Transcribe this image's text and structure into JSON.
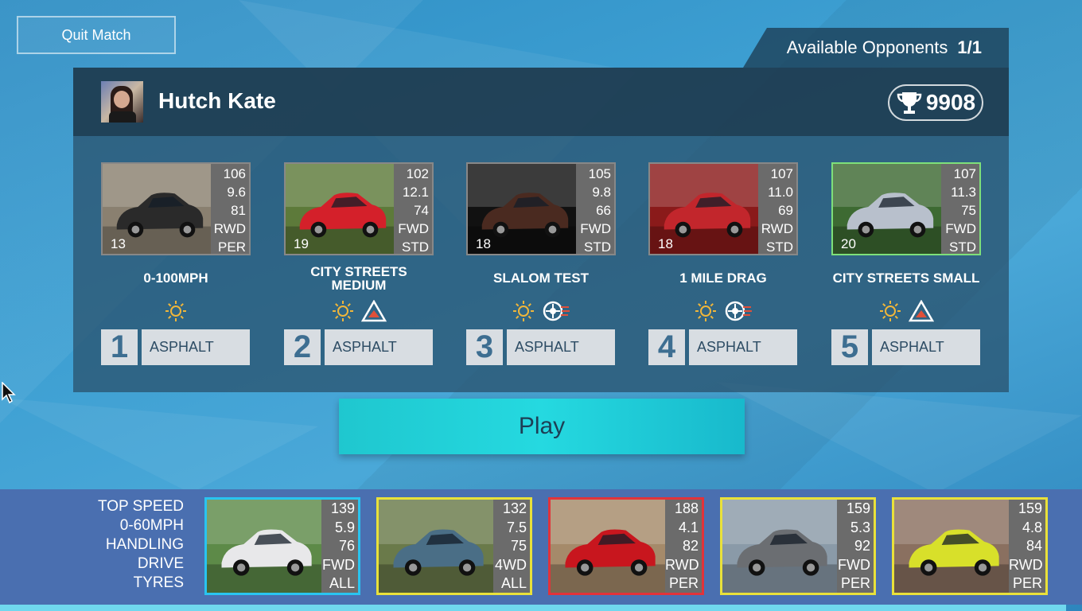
{
  "header": {
    "quit_label": "Quit Match",
    "available_label": "Available Opponents",
    "available_count": "1/1"
  },
  "opponent": {
    "name": "Hutch Kate",
    "trophies": "9908",
    "cars": [
      {
        "stats": [
          "106",
          "9.6",
          "81",
          "RWD",
          "PER"
        ],
        "rating": "13",
        "color": "#2a2a2a",
        "bg": "#8a8070"
      },
      {
        "stats": [
          "102",
          "12.1",
          "74",
          "FWD",
          "STD"
        ],
        "rating": "19",
        "color": "#d4202a",
        "bg": "#5d7a3a"
      },
      {
        "stats": [
          "105",
          "9.8",
          "66",
          "FWD",
          "STD"
        ],
        "rating": "18",
        "color": "#4a2a20",
        "bg": "#111111"
      },
      {
        "stats": [
          "107",
          "11.0",
          "69",
          "RWD",
          "STD"
        ],
        "rating": "18",
        "color": "#c2262c",
        "bg": "#8a1a1a"
      },
      {
        "stats": [
          "107",
          "11.3",
          "75",
          "FWD",
          "STD"
        ],
        "rating": "20",
        "color": "#b8c0cc",
        "bg": "#3d6a32"
      }
    ]
  },
  "events": [
    {
      "name": "0-100MPH",
      "number": "1",
      "surface": "ASPHALT",
      "icons": [
        "sun-icon"
      ]
    },
    {
      "name": "CITY STREETS MEDIUM",
      "number": "2",
      "surface": "ASPHALT",
      "icons": [
        "sun-icon",
        "warning-triangle-icon"
      ]
    },
    {
      "name": "SLALOM TEST",
      "number": "3",
      "surface": "ASPHALT",
      "icons": [
        "sun-icon",
        "tyre-icon"
      ]
    },
    {
      "name": "1 MILE DRAG",
      "number": "4",
      "surface": "ASPHALT",
      "icons": [
        "sun-icon",
        "tyre-icon"
      ]
    },
    {
      "name": "CITY STREETS SMALL",
      "number": "5",
      "surface": "ASPHALT",
      "icons": [
        "sun-icon",
        "warning-triangle-icon"
      ]
    }
  ],
  "play_label": "Play",
  "player": {
    "stat_labels": [
      "TOP SPEED",
      "0-60MPH",
      "HANDLING",
      "DRIVE",
      "TYRES"
    ],
    "cars": [
      {
        "stats": [
          "139",
          "5.9",
          "76",
          "FWD",
          "ALL"
        ],
        "border": "blue",
        "color": "#e8e8ea",
        "bg": "#5d8a48"
      },
      {
        "stats": [
          "132",
          "7.5",
          "75",
          "4WD",
          "ALL"
        ],
        "border": "yellow",
        "color": "#4a6e86",
        "bg": "#6a7a4a"
      },
      {
        "stats": [
          "188",
          "4.1",
          "82",
          "RWD",
          "PER"
        ],
        "border": "red",
        "color": "#c8161e",
        "bg": "#a58a6a"
      },
      {
        "stats": [
          "159",
          "5.3",
          "92",
          "FWD",
          "PER"
        ],
        "border": "yellow",
        "color": "#6b6e72",
        "bg": "#8a9aa8"
      },
      {
        "stats": [
          "159",
          "4.8",
          "84",
          "RWD",
          "PER"
        ],
        "border": "yellow",
        "color": "#d8e02a",
        "bg": "#8a7060"
      }
    ]
  },
  "colors": {
    "play_button": "#22d3dc",
    "selected_green": "#7ee07a",
    "icon_sun": "#f0b63a",
    "icon_warning": "#e0503a"
  }
}
